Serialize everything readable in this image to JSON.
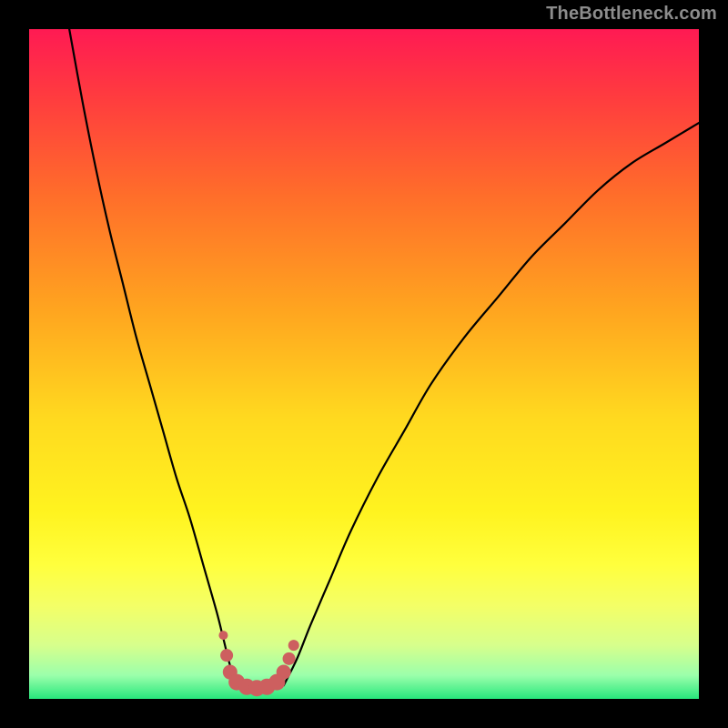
{
  "attribution": "TheBottleneck.com",
  "colors": {
    "frame": "#000000",
    "curve": "#000000",
    "marker_fill": "#cd5f5f",
    "marker_stroke": "#cd5f5f"
  },
  "chart_data": {
    "type": "line",
    "title": "",
    "xlabel": "",
    "ylabel": "",
    "xlim": [
      0,
      100
    ],
    "ylim": [
      0,
      100
    ],
    "grid": false,
    "legend": false,
    "gradient_stops": [
      {
        "pos": 0.0,
        "color": "#ff1a53"
      },
      {
        "pos": 0.1,
        "color": "#ff3b3f"
      },
      {
        "pos": 0.25,
        "color": "#ff6e2a"
      },
      {
        "pos": 0.42,
        "color": "#ffa51f"
      },
      {
        "pos": 0.58,
        "color": "#ffd91f"
      },
      {
        "pos": 0.72,
        "color": "#fff31f"
      },
      {
        "pos": 0.8,
        "color": "#ffff3d"
      },
      {
        "pos": 0.86,
        "color": "#f4ff66"
      },
      {
        "pos": 0.92,
        "color": "#d7ff8c"
      },
      {
        "pos": 0.965,
        "color": "#9bffab"
      },
      {
        "pos": 1.0,
        "color": "#27e77c"
      }
    ],
    "series": [
      {
        "name": "left-branch",
        "x": [
          6,
          8,
          10,
          12,
          14,
          16,
          18,
          20,
          22,
          24,
          26,
          28,
          29,
          30,
          31
        ],
        "y": [
          100,
          89,
          79,
          70,
          62,
          54,
          47,
          40,
          33,
          27,
          20,
          13,
          9,
          5,
          2
        ]
      },
      {
        "name": "right-branch",
        "x": [
          38,
          40,
          42,
          45,
          48,
          52,
          56,
          60,
          65,
          70,
          75,
          80,
          85,
          90,
          95,
          100
        ],
        "y": [
          2,
          6,
          11,
          18,
          25,
          33,
          40,
          47,
          54,
          60,
          66,
          71,
          76,
          80,
          83,
          86
        ]
      }
    ],
    "markers": {
      "name": "valley-highlight",
      "color": "#cd5f5f",
      "points": [
        {
          "x": 29.0,
          "y": 9.5,
          "r": 5
        },
        {
          "x": 29.5,
          "y": 6.5,
          "r": 7
        },
        {
          "x": 30.0,
          "y": 4.0,
          "r": 8
        },
        {
          "x": 31.0,
          "y": 2.5,
          "r": 9
        },
        {
          "x": 32.5,
          "y": 1.8,
          "r": 9
        },
        {
          "x": 34.0,
          "y": 1.6,
          "r": 9
        },
        {
          "x": 35.5,
          "y": 1.8,
          "r": 9
        },
        {
          "x": 37.0,
          "y": 2.5,
          "r": 9
        },
        {
          "x": 38.0,
          "y": 4.0,
          "r": 8
        },
        {
          "x": 38.8,
          "y": 6.0,
          "r": 7
        },
        {
          "x": 39.5,
          "y": 8.0,
          "r": 6
        }
      ]
    }
  }
}
